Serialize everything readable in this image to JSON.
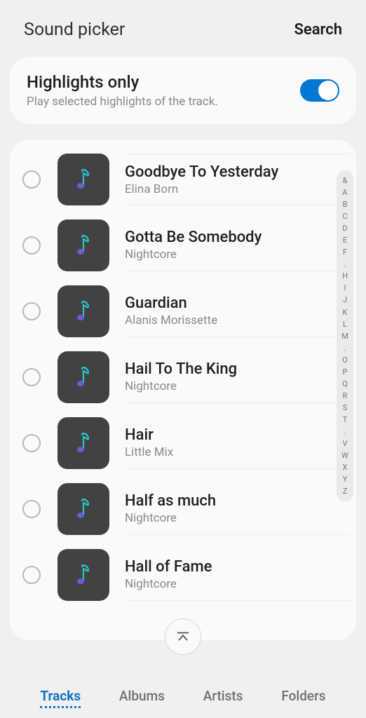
{
  "header": {
    "title": "Sound picker",
    "search": "Search"
  },
  "highlights": {
    "title": "Highlights only",
    "sub": "Play selected highlights of the track."
  },
  "tracks": [
    {
      "title": "Goodbye To Yesterday",
      "artist": "Elina Born"
    },
    {
      "title": "Gotta Be Somebody",
      "artist": "Nightcore"
    },
    {
      "title": "Guardian",
      "artist": "Alanis Morissette"
    },
    {
      "title": "Hail To The King",
      "artist": "Nightcore"
    },
    {
      "title": "Hair",
      "artist": "Little Mix"
    },
    {
      "title": "Half as much",
      "artist": "Nightcore"
    },
    {
      "title": "Hall of Fame",
      "artist": "Nightcore"
    }
  ],
  "index": [
    "&",
    "A",
    "B",
    "C",
    "D",
    "E",
    "F",
    ".",
    "H",
    "I",
    "J",
    "K",
    "L",
    "M",
    ".",
    "O",
    "P",
    "Q",
    "R",
    "S",
    "T",
    ".",
    "V",
    "W",
    "X",
    "Y",
    "Z"
  ],
  "tabs": {
    "tracks": "Tracks",
    "albums": "Albums",
    "artists": "Artists",
    "folders": "Folders"
  }
}
